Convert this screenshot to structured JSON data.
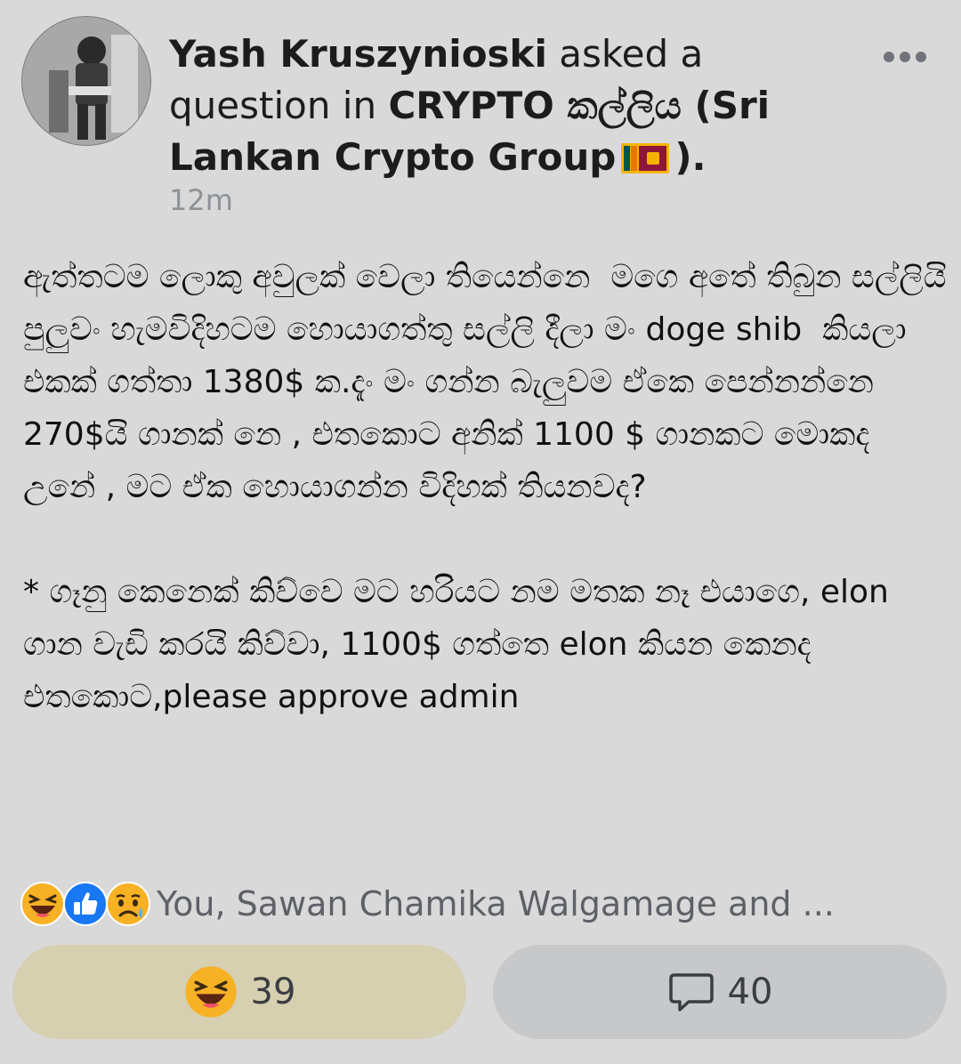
{
  "post": {
    "author": "Yash Kruszynioski",
    "action_text": " asked a question in ",
    "group_name": "CRYPTO කල්ලිය (Sri Lankan Crypto Group",
    "group_suffix": ").",
    "timestamp": "12m",
    "body": "ඇත්තටම ලොකු අවුලක් වෙලා තියෙන්නෙ  මගෙ අතේ තිබුන සල්ලියි පුලුවං හැමවිදිහටම හොයාගත්තු සල්ලි දීලා මං doge shib  කියලා එකක් ගත්තා 1380$ ක.දැං මං ගන්න බැලුවම ඒකෙ පෙන්නන්නෙ 270$යි ගානක් නෙ , එතකොට අනික් 1100 $ ගානකට මොකද උනේ , මට ඒක හොයාගන්න විදිහක් තියනවද?\n\n* ගෑනු කෙනෙක් කිව්වෙ මට හරියට නම මතක නෑ එයාගෙ, elon ගාන වැඩි කරයි කිව්වා, 1100$ ගත්තෙ elon කියන කෙනද එතකොට,please approve admin"
  },
  "reactions": {
    "icons": [
      "haha-emoji-icon",
      "like-icon",
      "sad-emoji-icon"
    ],
    "summary": "You, Sawan Chamika Walgamage and ..."
  },
  "actions": {
    "haha_count": "39",
    "comment_count": "40"
  },
  "colors": {
    "background": "#d9d9da",
    "haha_button_bg": "#d6cfb0",
    "comment_button_bg": "#c7c8ca",
    "timestamp": "#8d9296",
    "like_blue": "#1877f2",
    "emoji_yellow": "#f7b125"
  }
}
